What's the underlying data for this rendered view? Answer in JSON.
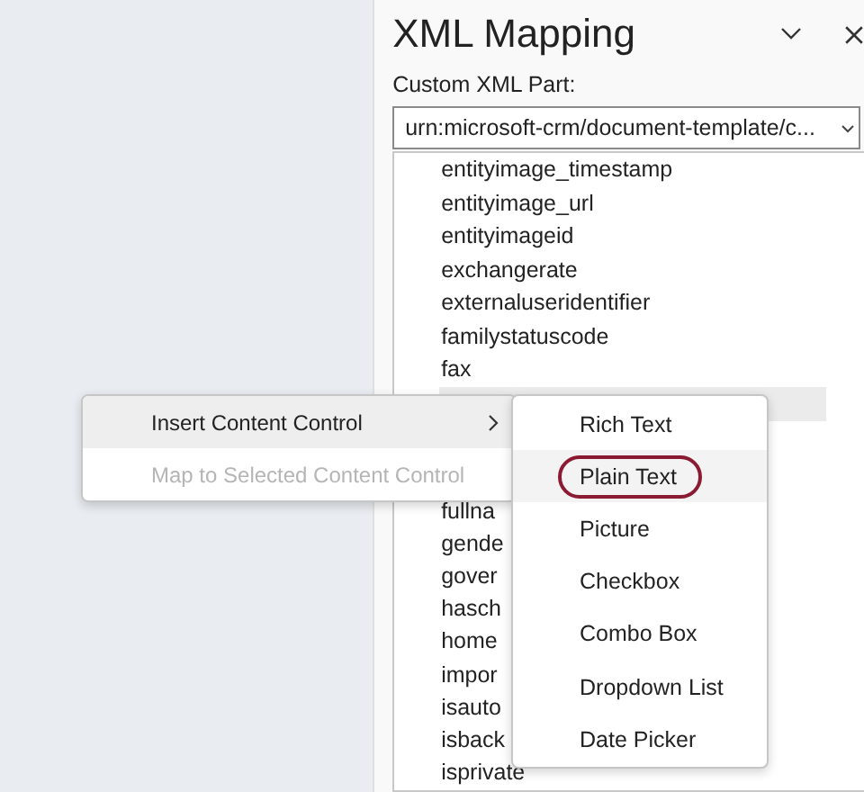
{
  "panel": {
    "title": "XML Mapping",
    "part_label": "Custom XML Part:",
    "part_value": "urn:microsoft-crm/document-template/c..."
  },
  "tree": {
    "above": [
      {
        "label": "entityimage_timestamp",
        "selected": false
      },
      {
        "label": "entityimage_url",
        "selected": false
      },
      {
        "label": "entityimageid",
        "selected": false
      },
      {
        "label": "exchangerate",
        "selected": false
      },
      {
        "label": "externaluseridentifier",
        "selected": false
      },
      {
        "label": "familystatuscode",
        "selected": false
      },
      {
        "label": "fax",
        "selected": false
      }
    ],
    "selected_row": {
      "selected": true
    },
    "below": [
      {
        "label": "fullna",
        "selected": false
      },
      {
        "label": "gende",
        "selected": false
      },
      {
        "label": "gover",
        "selected": false
      },
      {
        "label": "hasch",
        "selected": false
      },
      {
        "label": "home",
        "selected": false
      },
      {
        "label": "impor",
        "selected": false
      },
      {
        "label": "isauto",
        "selected": false
      },
      {
        "label": "isback",
        "selected": false
      },
      {
        "label": "isprivate",
        "selected": false
      }
    ]
  },
  "context_menu": {
    "items": [
      {
        "label": "Insert Content Control",
        "selected": true,
        "disabled": false,
        "submenu": true
      },
      {
        "label": "Map to Selected Content Control",
        "selected": false,
        "disabled": true,
        "submenu": false
      }
    ]
  },
  "submenu": {
    "items": [
      {
        "label": "Rich Text",
        "selected": false,
        "circled": false
      },
      {
        "label": "Plain Text",
        "selected": true,
        "circled": true
      },
      {
        "label": "Picture",
        "selected": false,
        "circled": false
      },
      {
        "label": "Checkbox",
        "selected": false,
        "circled": false
      },
      {
        "label": "Combo Box",
        "selected": false,
        "circled": false
      },
      {
        "label": "Dropdown List",
        "selected": false,
        "circled": false
      },
      {
        "label": "Date Picker",
        "selected": false,
        "circled": false
      }
    ]
  }
}
